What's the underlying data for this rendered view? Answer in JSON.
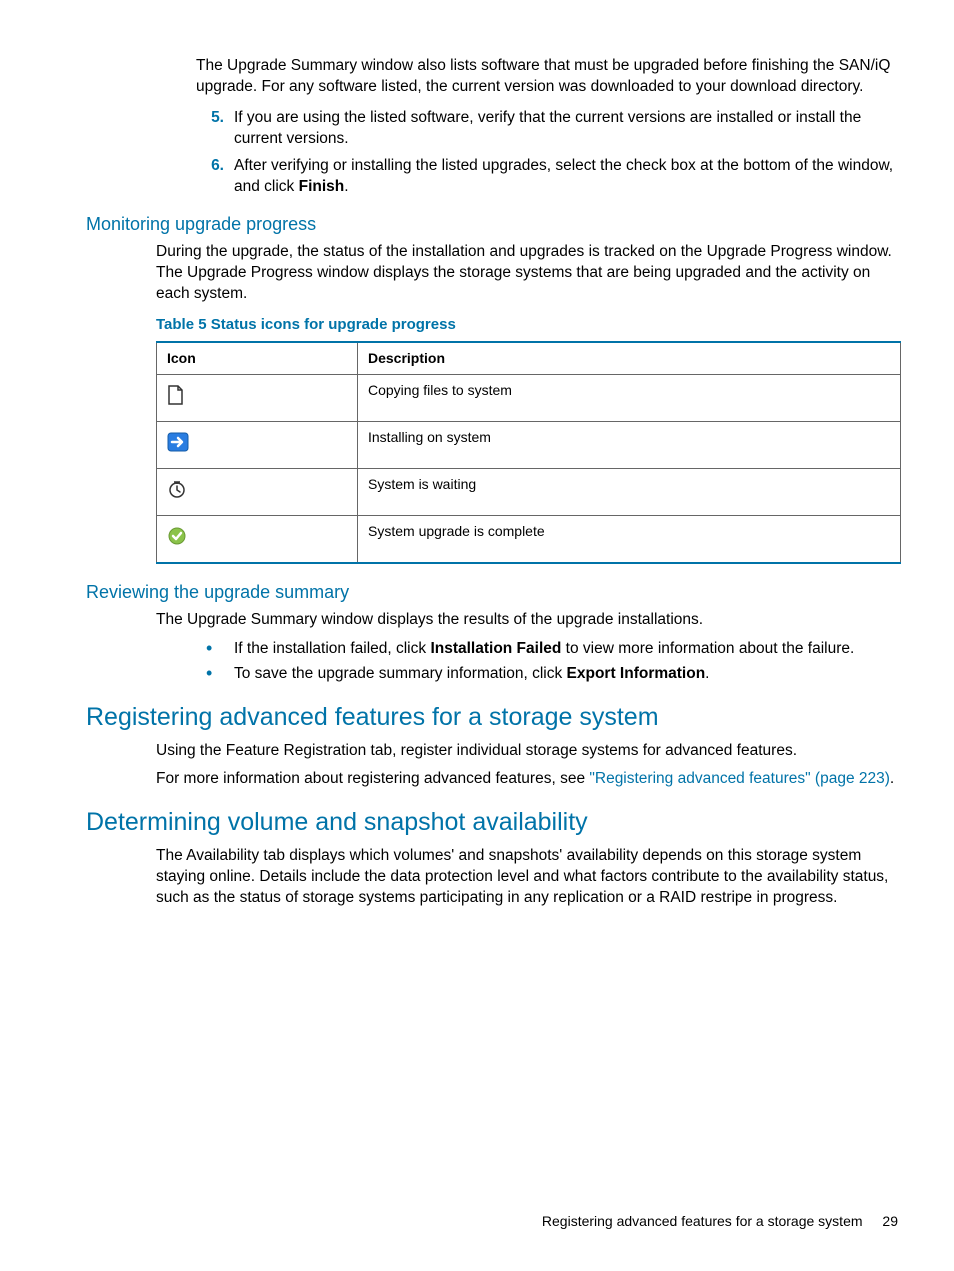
{
  "intro": "The Upgrade Summary window also lists software that must be upgraded before finishing the SAN/iQ upgrade. For any software listed, the current version was downloaded to your download directory.",
  "steps": {
    "s5_num": "5.",
    "s5": "If you are using the listed software, verify that the current versions are installed or install the current versions.",
    "s6_num": "6.",
    "s6a": "After verifying or installing the listed upgrades, select the check box at the bottom of the window, and click ",
    "s6b": "Finish",
    "s6c": "."
  },
  "sec_monitor": {
    "title": "Monitoring upgrade progress",
    "para": "During the upgrade, the status of the installation and upgrades is tracked on the Upgrade Progress window. The Upgrade Progress window displays the storage systems that are being upgraded and the activity on each system.",
    "table_caption": "Table 5 Status icons for upgrade progress",
    "th_icon": "Icon",
    "th_desc": "Description",
    "rows": {
      "r1": "Copying files to system",
      "r2": "Installing on system",
      "r3": "System is waiting",
      "r4": "System upgrade is complete"
    }
  },
  "sec_review": {
    "title": "Reviewing the upgrade summary",
    "para": "The Upgrade Summary window displays the results of the upgrade installations.",
    "b1a": "If the installation failed, click ",
    "b1b": "Installation Failed",
    "b1c": " to view more information about the failure.",
    "b2a": "To save the upgrade summary information, click ",
    "b2b": "Export Information",
    "b2c": "."
  },
  "sec_register": {
    "title": "Registering advanced features for a storage system",
    "p1": "Using the Feature Registration tab, register individual storage systems for advanced features.",
    "p2a": "For more information about registering advanced features, see ",
    "p2b": "\"Registering advanced features\" (page 223)",
    "p2c": "."
  },
  "sec_determine": {
    "title": "Determining volume and snapshot availability",
    "p1": "The Availability tab displays which volumes' and snapshots' availability depends on this storage system staying online. Details include the data protection level and what factors contribute to the availability status, such as the status of storage systems participating in any replication or a RAID restripe in progress."
  },
  "footer": {
    "text": "Registering advanced features for a storage system",
    "page": "29"
  }
}
